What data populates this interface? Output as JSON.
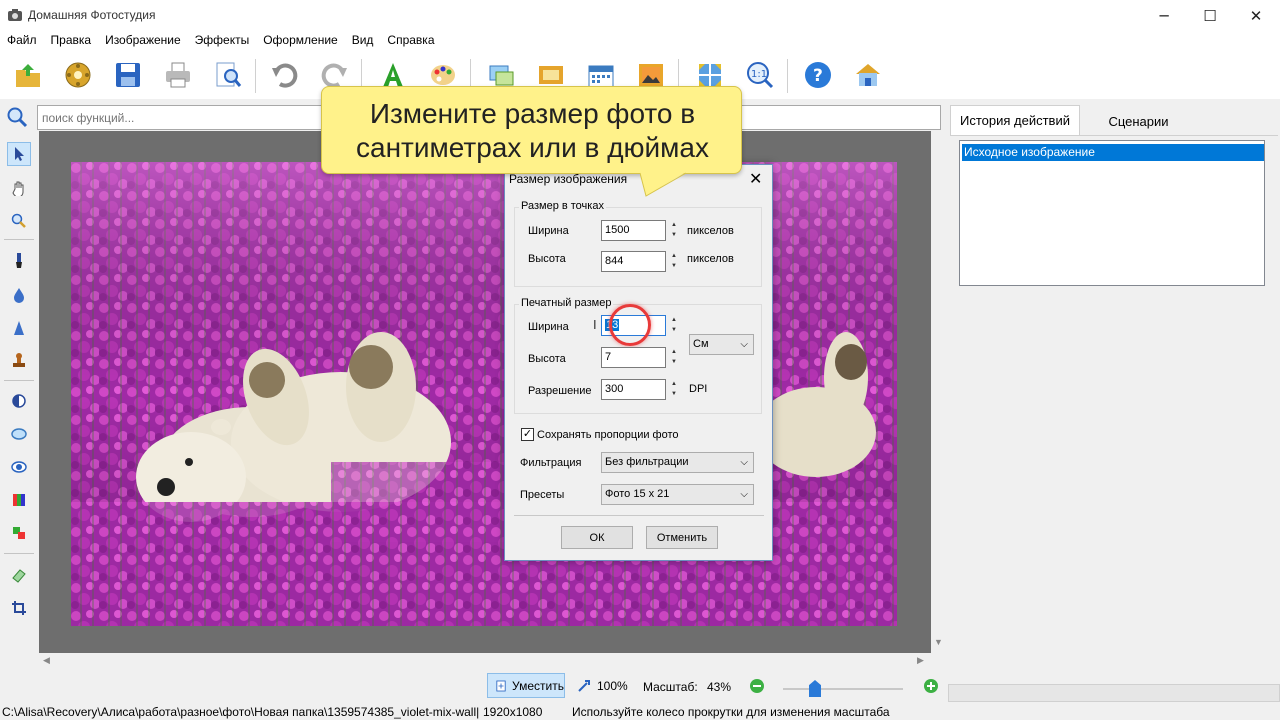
{
  "window": {
    "title": "Домашняя Фотостудия",
    "minimize": "─",
    "maximize": "☐",
    "close": "✕"
  },
  "menu": [
    "Файл",
    "Правка",
    "Изображение",
    "Эффекты",
    "Оформление",
    "Вид",
    "Справка"
  ],
  "search": {
    "placeholder": "поиск функций..."
  },
  "right_panel": {
    "tab_history": "История действий",
    "tab_scenarios": "Сценарии",
    "history_items": [
      "Исходное изображение"
    ]
  },
  "callout": {
    "line1": "Измените размер фото в",
    "line2": "сантиметрах или в дюймах"
  },
  "dialog": {
    "title": "Размер изображения",
    "close": "✕",
    "pixels_group": "Размер в точках",
    "width_label": "Ширина",
    "height_label": "Высота",
    "px_width": "1500",
    "px_height": "844",
    "px_unit": "пикселов",
    "print_group": "Печатный размер",
    "print_width": "13",
    "print_height": "7",
    "resolution_label": "Разрешение",
    "resolution": "300",
    "dpi": "DPI",
    "unit_select": "См",
    "keep_ratio": "Сохранять пропорции фото",
    "keep_ratio_checked": true,
    "filter_label": "Фильтрация",
    "filter_value": "Без фильтрации",
    "presets_label": "Пресеты",
    "presets_value": "Фото 15 x 21",
    "ok": "ОК",
    "cancel": "Отменить"
  },
  "zoombar": {
    "fit": "Уместить",
    "zoom100": "100%",
    "scale_label": "Масштаб:",
    "scale_value": "43%"
  },
  "status": {
    "path": "C:\\Alisa\\Recovery\\Алиса\\работа\\разное\\фото\\Новая папка\\1359574385_violet-mix-wall|",
    "size": "1920x1080",
    "hint": "Используйте колесо прокрутки для изменения масштаба"
  },
  "colors": {
    "accent": "#0078d7",
    "callout": "#fff28a",
    "canvas_bg": "#6e6e6e",
    "flowers": "#b02cb0"
  },
  "toolbar_icons": [
    "open-icon",
    "filmstrip-icon",
    "save-icon",
    "print-icon",
    "preview-icon",
    "undo-icon",
    "redo-icon",
    "text-icon",
    "palette-icon",
    "collage-icon",
    "frame-icon",
    "calendar-icon",
    "postcard-icon",
    "fit-icon",
    "zoom-actual-icon",
    "help-icon",
    "home-icon"
  ],
  "tool_icons": [
    "pointer-icon",
    "hand-icon",
    "zoom-icon",
    "brush-icon",
    "blur-icon",
    "sharpen-icon",
    "stamp-icon",
    "contrast-icon",
    "lens-icon",
    "redeye-icon",
    "color-icon",
    "replace-icon",
    "eraser-icon",
    "crop-icon"
  ]
}
